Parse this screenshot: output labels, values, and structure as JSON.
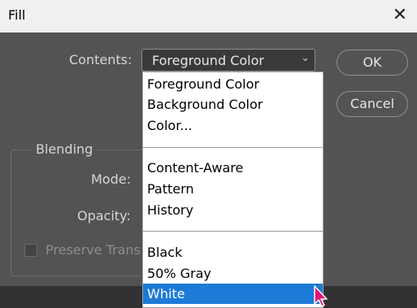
{
  "window": {
    "title": "Fill"
  },
  "contents": {
    "label": "Contents:",
    "selected": "Foreground Color",
    "options": [
      "Foreground Color",
      "Background Color",
      "Color...",
      "Content-Aware",
      "Pattern",
      "History",
      "Black",
      "50% Gray",
      "White"
    ],
    "highlighted": "White"
  },
  "buttons": {
    "ok": "OK",
    "cancel": "Cancel"
  },
  "blending": {
    "title": "Blending",
    "mode_label": "Mode:",
    "opacity_label": "Opacity:",
    "preserve_label": "Preserve Trans"
  },
  "colors": {
    "selection": "#1c7bd6",
    "cursor": "#e0157a"
  }
}
